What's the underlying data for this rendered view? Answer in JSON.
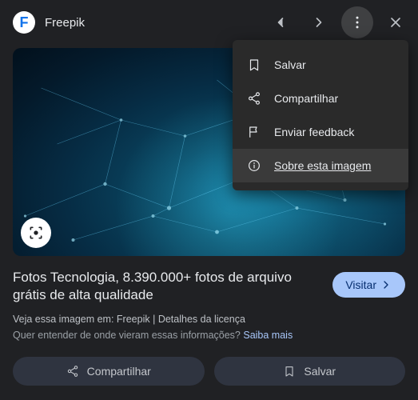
{
  "header": {
    "brand_name": "Freepik",
    "brand_initial": "F"
  },
  "dropdown": {
    "save": "Salvar",
    "share": "Compartilhar",
    "feedback": "Enviar feedback",
    "about": "Sobre esta imagem"
  },
  "title": "Fotos Tecnologia, 8.390.000+ fotos de arquivo grátis de alta qualidade",
  "visit_label": "Visitar",
  "meta_prefix": "Veja essa imagem em: ",
  "meta_source": "Freepik",
  "meta_sep": " | ",
  "meta_license": "Detalhes da licença",
  "meta_question": "Quer entender de onde vieram essas informações? ",
  "meta_learn_more": "Saiba mais",
  "actions": {
    "share": "Compartilhar",
    "save": "Salvar"
  }
}
